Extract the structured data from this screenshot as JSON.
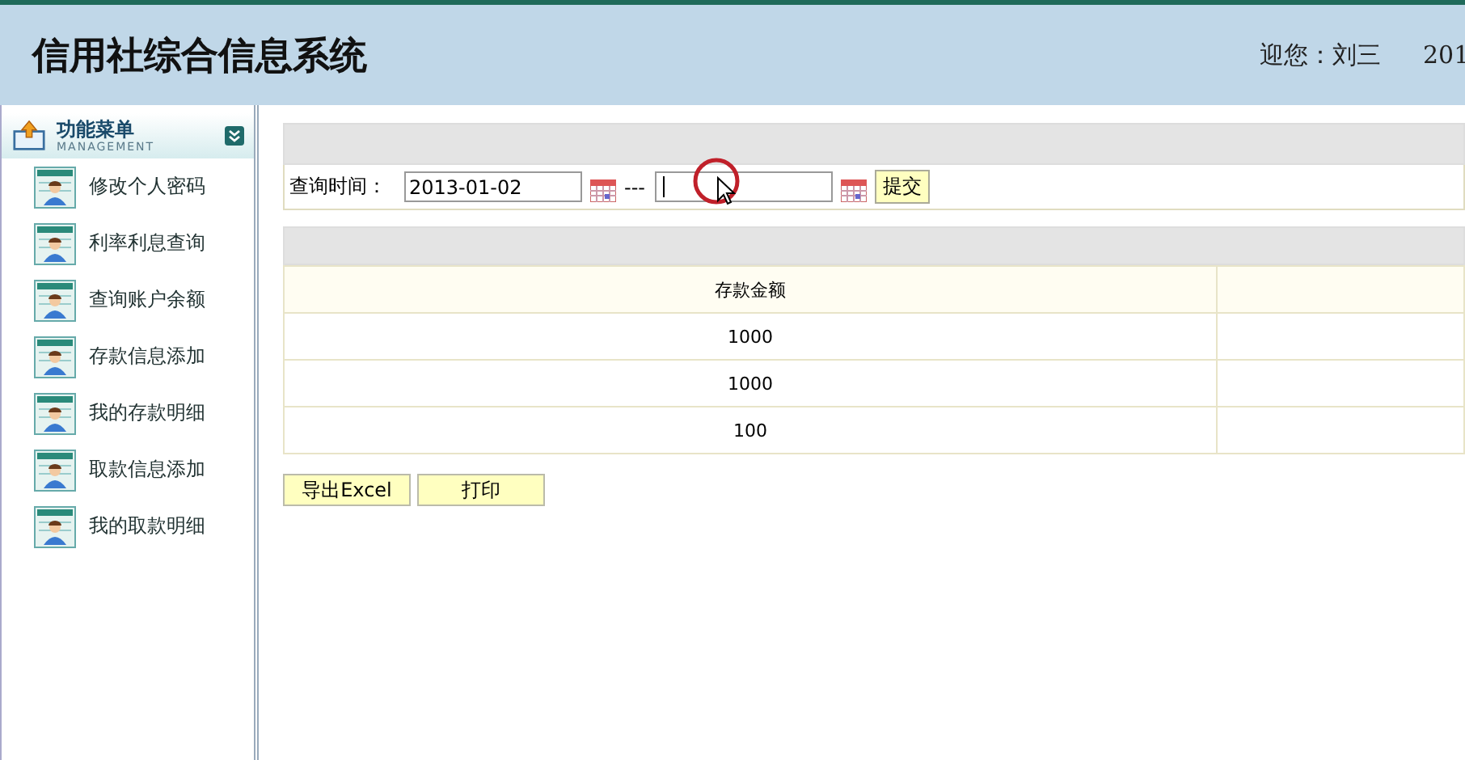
{
  "header": {
    "title": "信用社综合信息系统",
    "greeting": "迎您：刘三",
    "date": "201"
  },
  "sidebar": {
    "title": "功能菜单",
    "subtitle": "MANAGEMENT",
    "items": [
      {
        "label": "修改个人密码"
      },
      {
        "label": "利率利息查询"
      },
      {
        "label": "查询账户余额"
      },
      {
        "label": "存款信息添加"
      },
      {
        "label": "我的存款明细"
      },
      {
        "label": "取款信息添加"
      },
      {
        "label": "我的取款明细"
      }
    ]
  },
  "query": {
    "label": "查询时间：",
    "date_from": "2013-01-02",
    "separator": "---",
    "submit": "提交"
  },
  "table": {
    "columns": [
      "存款金额"
    ],
    "rows": [
      [
        "1000"
      ],
      [
        "1000"
      ],
      [
        "100"
      ]
    ]
  },
  "buttons": [
    "导出Excel",
    "打印"
  ]
}
